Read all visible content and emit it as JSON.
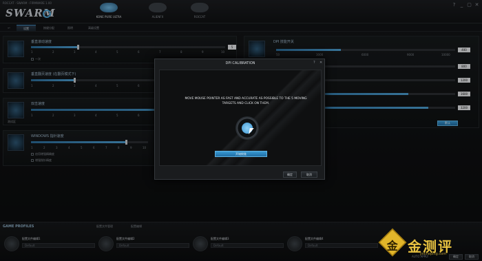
{
  "app": {
    "brand_small": "ROCCAT · SWARM · FIRMWARE 1.00",
    "logo": "SWARM",
    "logo_prefix": "ROCCAT"
  },
  "devices": [
    {
      "label": "KONE PURE ULTRA",
      "active": true
    },
    {
      "label": "ALIENFX",
      "active": false
    },
    {
      "label": "ROCCAT",
      "active": false
    }
  ],
  "window_controls": [
    "?",
    "_",
    "▢",
    "✕"
  ],
  "nav": {
    "items": [
      "设置",
      "按键分配",
      "照明",
      "高级设置"
    ],
    "active": 0
  },
  "panels": {
    "sensitivity": {
      "title": "垂直滚动速度",
      "ticks": [
        "1",
        "2",
        "3",
        "4",
        "5",
        "6",
        "7",
        "8",
        "9",
        "10"
      ],
      "value": "5",
      "check": "一次"
    },
    "scroll": {
      "title": "垂直翻页速度 (在翻页模式下)",
      "ticks": [
        "1",
        "2",
        "3",
        "4",
        "5",
        "6",
        "7",
        "8",
        "9",
        "10"
      ],
      "value": "3"
    },
    "double_click": {
      "title": "双击速度",
      "ticks": [
        "1",
        "2",
        "3",
        "4",
        "5",
        "6",
        "7",
        "8",
        "9",
        "10"
      ],
      "icon_label": "测试区"
    },
    "windows": {
      "title": "WINDOWS 指针速度",
      "ticks": [
        "1",
        "2",
        "3",
        "4",
        "5",
        "6",
        "7",
        "8",
        "9",
        "10"
      ],
      "checks": [
        "启用增强精确度",
        "增强指针精度"
      ]
    },
    "dpi": {
      "title": "DPI 技能开关",
      "scale": [
        "50",
        "3000",
        "6000",
        "9000",
        "10000"
      ],
      "values": [
        "400",
        "800",
        "1200",
        "1600",
        "3200"
      ],
      "button": "默认"
    }
  },
  "dialog": {
    "title": "DPI CALIBRATION",
    "controls": [
      "?",
      "✕"
    ],
    "message": "MOVE MOUSE POINTER AS FAST AND ACCURATE AS POSSIBLE TO THE 5 MOVING TARGETS AND CLICK ON THEM.",
    "start_button": "开始校准",
    "ok_button": "确定",
    "cancel_button": "取消"
  },
  "game_profiles": {
    "title": "GAME PROFILES",
    "tabs": [
      "配置文件管理",
      "配置编辑"
    ],
    "profiles": [
      {
        "name": "配置文件编辑1",
        "field": "Default"
      },
      {
        "name": "配置文件编辑2",
        "field": "Default"
      },
      {
        "name": "配置文件编辑3",
        "field": "Default"
      },
      {
        "name": "配置文件编辑4",
        "field": "Default"
      }
    ],
    "auto_apply": "AUTO APPLY",
    "ok": "确定",
    "cancel": "取消"
  },
  "watermark": {
    "glyph": "金",
    "text": "金测评",
    "url": "jincheping.com"
  },
  "colors": {
    "accent": "#3f97d3",
    "watermark": "#e9c341"
  }
}
